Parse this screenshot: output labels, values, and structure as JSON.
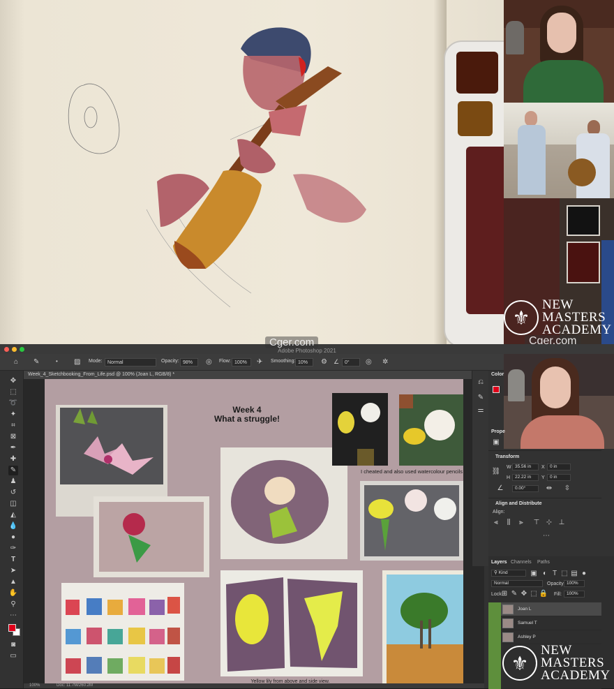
{
  "overlay": {
    "watermark_site": "Cger.com",
    "academy_line1": "NEW",
    "academy_line2": "MASTERS",
    "academy_line3": "ACADEMY"
  },
  "window": {
    "app_title": "Adobe Photoshop 2021",
    "document_tab": "Week_4_Sketchbooking_From_Life.psd @ 100% (Joan L, RGB/8) *"
  },
  "options_bar": {
    "mode_label": "Mode:",
    "mode_value": "Normal",
    "opacity_label": "Opacity:",
    "opacity_value": "98%",
    "flow_label": "Flow:",
    "flow_value": "100%",
    "smoothing_label": "Smoothing:",
    "smoothing_value": "10%",
    "angle_value": "0°"
  },
  "canvas": {
    "title_line1": "Week 4",
    "title_line2": "What a struggle!",
    "caption_pencils": "I cheated and also used watercolour pencils",
    "caption_lily": "Yellow lily from above and side view."
  },
  "panels": {
    "color_tab": "Color",
    "properties_tab": "Prope",
    "transform": {
      "heading": "Transform",
      "w_label": "W",
      "w_value": "35.56 in",
      "h_label": "H",
      "h_value": "22.22 in",
      "x_label": "X",
      "x_value": "0 in",
      "y_label": "Y",
      "y_value": "0 in",
      "angle_value": "0.00°"
    },
    "align": {
      "heading": "Align and Distribute",
      "label": "Align:"
    },
    "layers": {
      "tabs": [
        "Layers",
        "Channels",
        "Paths"
      ],
      "filter_value": "Kind",
      "blend_value": "Normal",
      "opacity_label": "Opacity:",
      "opacity_value": "100%",
      "lock_label": "Lock:",
      "fill_label": "Fill:",
      "fill_value": "100%",
      "items": [
        {
          "name": "Joan L"
        },
        {
          "name": "Samuel T"
        },
        {
          "name": "Ashley P"
        }
      ]
    }
  },
  "status": {
    "zoom": "100%",
    "doc_size": "Doc: 11.7M/260.2M"
  },
  "colors": {
    "canvas_bg": "#b39ea2",
    "foreground_swatch": "#e0001a",
    "layer_eye_green": "#5e8f3c"
  }
}
